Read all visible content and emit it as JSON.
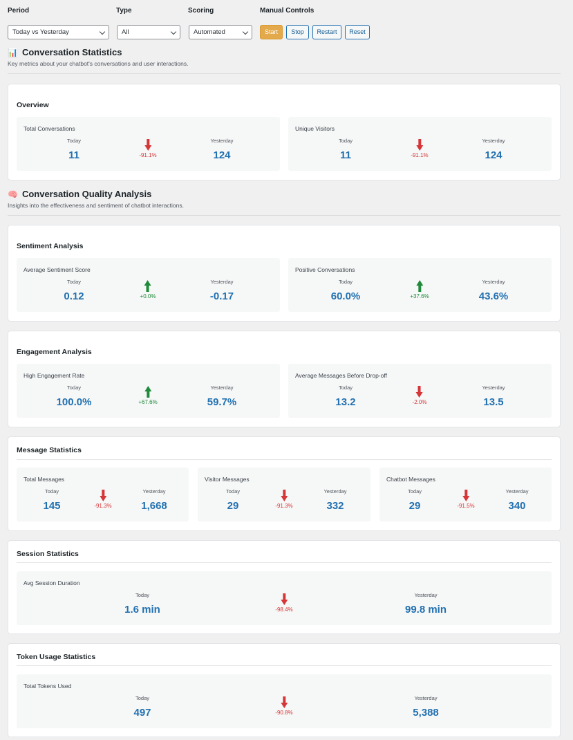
{
  "controls": {
    "period": {
      "label": "Period",
      "value": "Today vs Yesterday"
    },
    "type": {
      "label": "Type",
      "value": "All"
    },
    "scoring": {
      "label": "Scoring",
      "value": "Automated"
    },
    "manual": {
      "label": "Manual Controls",
      "start": "Start",
      "stop": "Stop",
      "restart": "Restart",
      "reset": "Reset"
    }
  },
  "colors": {
    "up": "#1f8a3a",
    "down": "#d63638",
    "value": "#2271b1",
    "start_button": "#e3a94a"
  },
  "sections": {
    "stats": {
      "icon": "bar-chart-emoji",
      "emoji": "📊",
      "title": "Conversation Statistics",
      "subtitle": "Key metrics about your chatbot's conversations and user interactions."
    },
    "quality": {
      "icon": "brain-emoji",
      "emoji": "🧠",
      "title": "Conversation Quality Analysis",
      "subtitle": "Insights into the effectiveness and sentiment of chatbot interactions."
    }
  },
  "labels": {
    "today": "Today",
    "yesterday": "Yesterday"
  },
  "overview": {
    "title": "Overview",
    "total_conversations": {
      "label": "Total Conversations",
      "today": "11",
      "yesterday": "124",
      "change": "-91.1%",
      "direction": "down"
    },
    "unique_visitors": {
      "label": "Unique Visitors",
      "today": "11",
      "yesterday": "124",
      "change": "-91.1%",
      "direction": "down"
    }
  },
  "sentiment": {
    "title": "Sentiment Analysis",
    "avg_score": {
      "label": "Average Sentiment Score",
      "today": "0.12",
      "yesterday": "-0.17",
      "change": "+0.0%",
      "direction": "up"
    },
    "positive": {
      "label": "Positive Conversations",
      "today": "60.0%",
      "yesterday": "43.6%",
      "change": "+37.6%",
      "direction": "up"
    }
  },
  "engagement": {
    "title": "Engagement Analysis",
    "high_rate": {
      "label": "High Engagement Rate",
      "today": "100.0%",
      "yesterday": "59.7%",
      "change": "+67.6%",
      "direction": "up"
    },
    "avg_messages": {
      "label": "Average Messages Before Drop-off",
      "today": "13.2",
      "yesterday": "13.5",
      "change": "-2.0%",
      "direction": "down"
    }
  },
  "messages": {
    "title": "Message Statistics",
    "total": {
      "label": "Total Messages",
      "today": "145",
      "yesterday": "1,668",
      "change": "-91.3%",
      "direction": "down"
    },
    "visitor": {
      "label": "Visitor Messages",
      "today": "29",
      "yesterday": "332",
      "change": "-91.3%",
      "direction": "down"
    },
    "chatbot": {
      "label": "Chatbot Messages",
      "today": "29",
      "yesterday": "340",
      "change": "-91.5%",
      "direction": "down"
    }
  },
  "session": {
    "title": "Session Statistics",
    "avg_duration": {
      "label": "Avg Session Duration",
      "today": "1.6 min",
      "yesterday": "99.8 min",
      "change": "-98.4%",
      "direction": "down"
    }
  },
  "tokens": {
    "title": "Token Usage Statistics",
    "total_used": {
      "label": "Total Tokens Used",
      "today": "497",
      "yesterday": "5,388",
      "change": "-90.8%",
      "direction": "down"
    }
  }
}
